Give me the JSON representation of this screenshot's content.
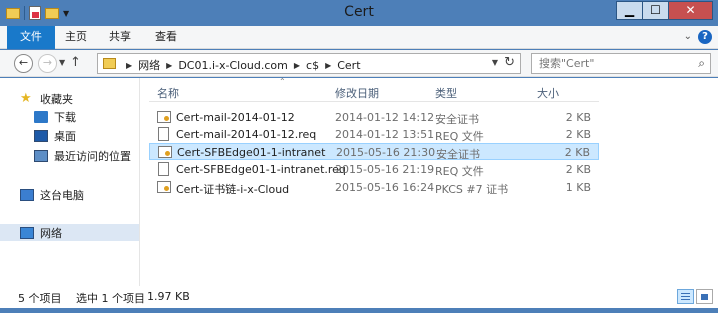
{
  "window": {
    "title": "Cert"
  },
  "ribbon": {
    "tabs": [
      "文件",
      "主页",
      "共享",
      "查看"
    ]
  },
  "address": {
    "crumbs": [
      "网络",
      "DC01.i-x-Cloud.com",
      "c$",
      "Cert"
    ]
  },
  "search": {
    "placeholder": "搜索\"Cert\""
  },
  "sidebar": {
    "favorites": "收藏夹",
    "items": [
      "下载",
      "桌面",
      "最近访问的位置"
    ],
    "this_pc": "这台电脑",
    "network": "网络"
  },
  "columns": {
    "name": "名称",
    "date": "修改日期",
    "type": "类型",
    "size": "大小"
  },
  "files": [
    {
      "name": "Cert-mail-2014-01-12",
      "date": "2014-01-12 14:12",
      "type": "安全证书",
      "size": "2 KB",
      "icon": "certificate-icon"
    },
    {
      "name": "Cert-mail-2014-01-12.req",
      "date": "2014-01-12 13:51",
      "type": "REQ 文件",
      "size": "2 KB",
      "icon": "file-icon"
    },
    {
      "name": "Cert-SFBEdge01-1-intranet",
      "date": "2015-05-16 21:30",
      "type": "安全证书",
      "size": "2 KB",
      "icon": "certificate-icon",
      "selected": true
    },
    {
      "name": "Cert-SFBEdge01-1-intranet.req",
      "date": "2015-05-16 21:19",
      "type": "REQ 文件",
      "size": "2 KB",
      "icon": "file-icon"
    },
    {
      "name": "Cert-证书链-i-x-Cloud",
      "date": "2015-05-16 16:24",
      "type": "PKCS #7 证书",
      "size": "1 KB",
      "icon": "certificate-icon"
    }
  ],
  "status": {
    "count": "5 个项目",
    "selection": "选中 1 个项目",
    "size": "1.97 KB"
  },
  "colors": {
    "titlebar": "#4d7fb8",
    "file_tab": "#1979ca",
    "selection": "#cce8ff",
    "close": "#c75050"
  }
}
